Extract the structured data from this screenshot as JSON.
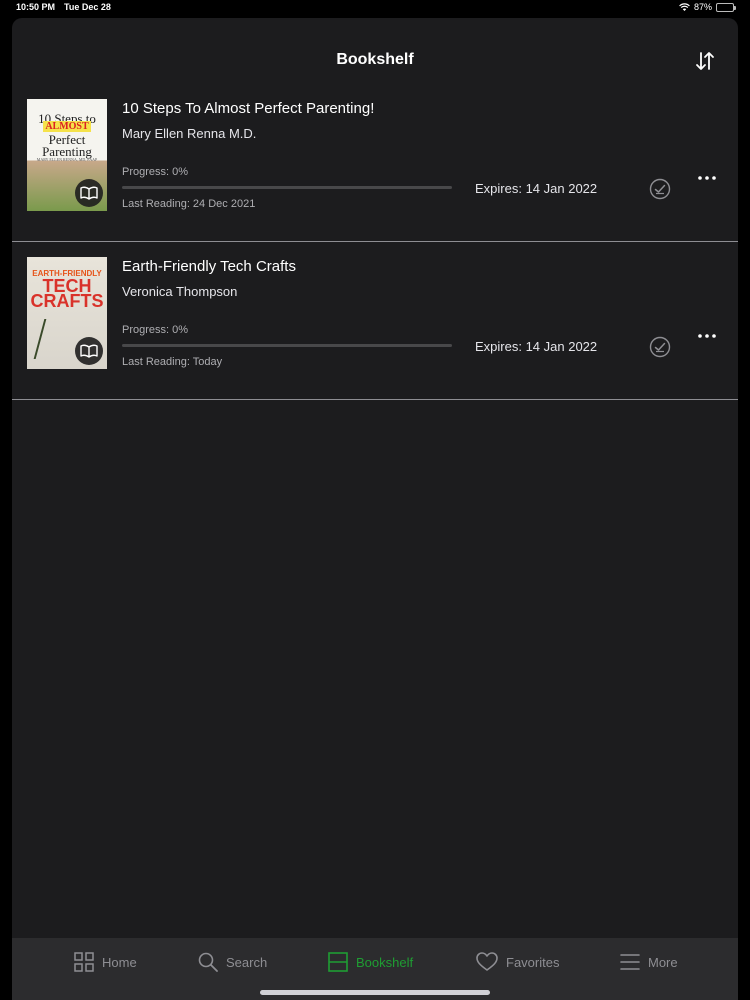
{
  "status": {
    "time": "10:50 PM",
    "date": "Tue Dec 28",
    "battery": "87%"
  },
  "header": {
    "title": "Bookshelf"
  },
  "books": [
    {
      "title": "10 Steps To Almost Perfect Parenting!",
      "author": "Mary Ellen Renna M.D.",
      "progress_label": "Progress: 0%",
      "progress": 0,
      "last_reading": "Last Reading: 24 Dec 2021",
      "expires": "Expires: 14 Jan 2022",
      "cover": {
        "line1": "10 Steps to",
        "line2": "ALMOST",
        "line3": "Perfect",
        "line4": "Parenting",
        "line5": "MARY ELLEN RENNA, MD, FAAP"
      }
    },
    {
      "title": "Earth-Friendly Tech Crafts",
      "author": "Veronica Thompson",
      "progress_label": "Progress: 0%",
      "progress": 0,
      "last_reading": "Last Reading: Today",
      "expires": "Expires: 14 Jan 2022",
      "cover": {
        "line1": "EARTH-FRIENDLY",
        "line2": "TECH",
        "line3": "CRAFTS"
      }
    }
  ],
  "tabs": [
    {
      "label": "Home",
      "icon": "grid-icon"
    },
    {
      "label": "Search",
      "icon": "search-icon"
    },
    {
      "label": "Bookshelf",
      "icon": "bookshelf-icon",
      "active": true
    },
    {
      "label": "Favorites",
      "icon": "heart-icon"
    },
    {
      "label": "More",
      "icon": "menu-icon"
    }
  ],
  "colors": {
    "accent": "#1f9d33",
    "background": "#000000",
    "sheet": "#1c1c1e",
    "tab_bar": "#2c2c2e"
  }
}
